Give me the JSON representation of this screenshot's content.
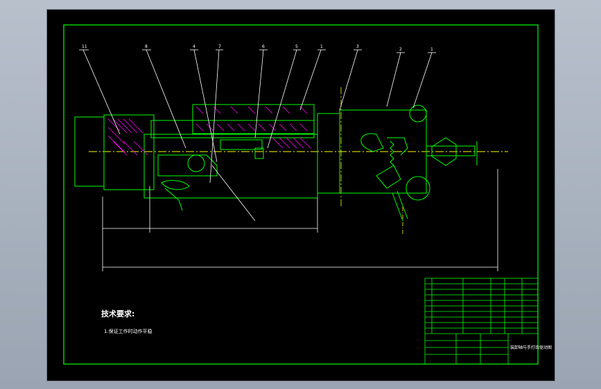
{
  "technical_requirements": {
    "title": "技术要求:",
    "item_1": "1.保证工作时动作平稳"
  },
  "title_block": {
    "drawing_title": "装卸轴与手打齿驱动图"
  },
  "colors": {
    "background_outer": "#a4acb8",
    "sheet": "#000000",
    "frame_line": "#00ff00",
    "part_line": "#00ff00",
    "hatch_line": "#ff00ff",
    "center_line": "#ffff00",
    "leader_line": "#ffffff",
    "text": "#ffffff"
  },
  "balloons": [
    "11",
    "8",
    "4",
    "7",
    "6",
    "5",
    "1",
    "3",
    "2",
    "1"
  ]
}
